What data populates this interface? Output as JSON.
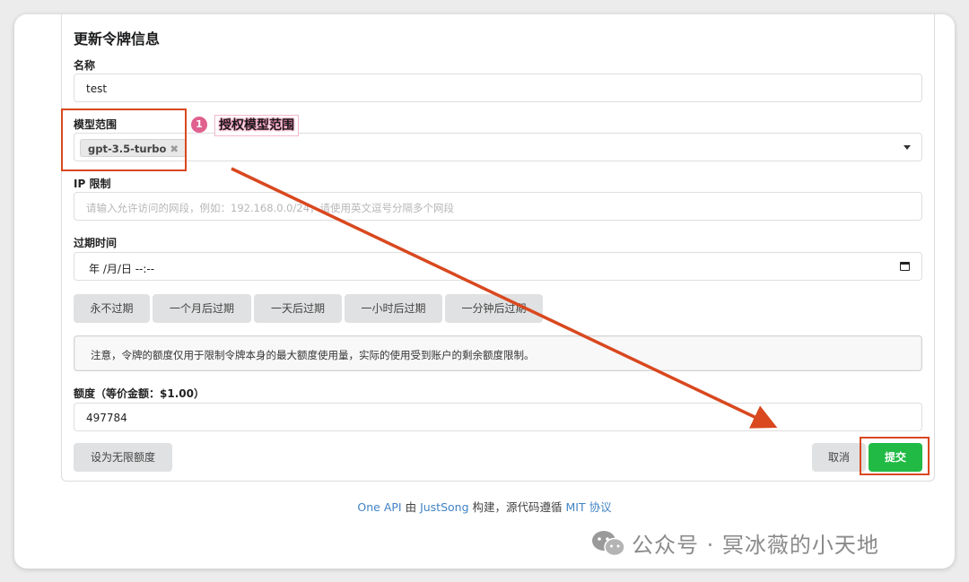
{
  "form": {
    "title": "更新令牌信息",
    "name_label": "名称",
    "name_value": "test",
    "models_label": "模型范围",
    "selected_models": [
      "gpt-3.5-turbo"
    ],
    "chip_remove": "✖",
    "ip_label": "IP 限制",
    "ip_placeholder": "请输入允许访问的网段，例如：192.168.0.0/24，请使用英文逗号分隔多个网段",
    "expiry_label": "过期时间",
    "expiry_value": "年 /月/日 --:--",
    "expiry_buttons": [
      "永不过期",
      "一个月后过期",
      "一天后过期",
      "一小时后过期",
      "一分钟后过期"
    ],
    "notice": "注意，令牌的额度仅用于限制令牌本身的最大额度使用量，实际的使用受到账户的剩余额度限制。",
    "quota_label": "额度（等价金额：$1.00）",
    "quota_value": "497784",
    "unlimited_button": "设为无限额度",
    "cancel_button": "取消",
    "submit_button": "提交"
  },
  "footer": {
    "one_api": "One API",
    "by": " 由 ",
    "author": "JustSong",
    "built": " 构建，源代码遵循 ",
    "license": "MIT 协议"
  },
  "annotation": {
    "number": "1",
    "text": "授权模型范围"
  },
  "watermark": {
    "text": "公众号 · 冥冰薇的小天地"
  },
  "colors": {
    "accent_red": "#d9481f",
    "submit_green": "#21ba45",
    "link_blue": "#4183c4",
    "badge_pink": "#e0608e"
  }
}
